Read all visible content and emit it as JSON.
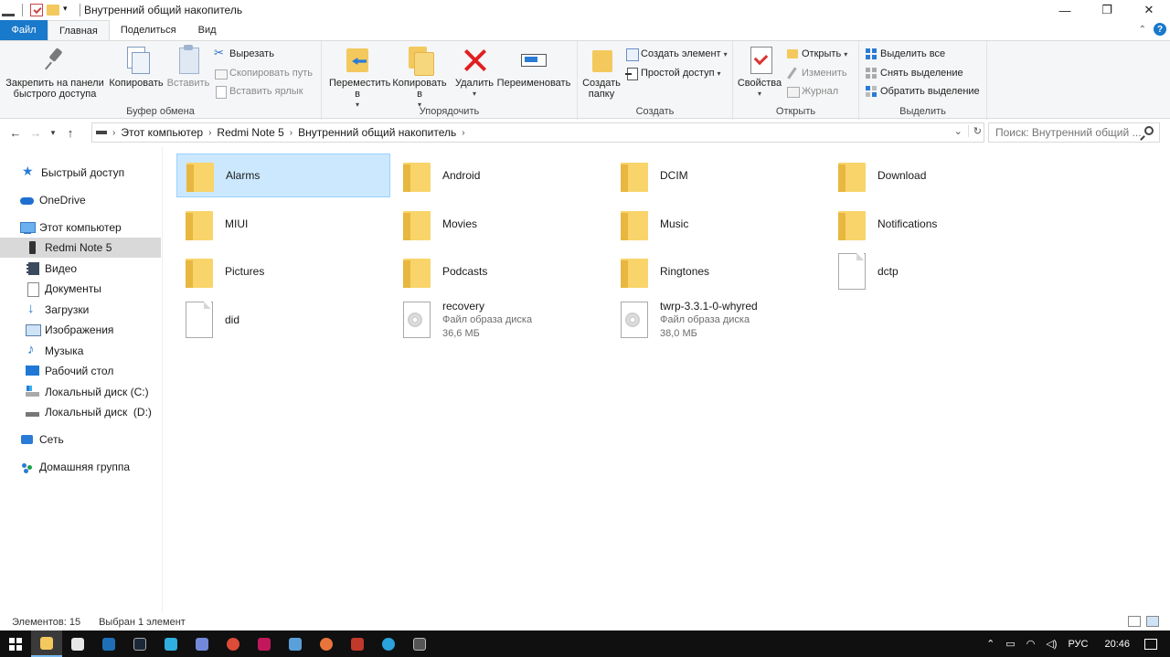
{
  "window": {
    "title": "Внутренний общий накопитель",
    "minimize": "—",
    "restore": "❐",
    "close": "✕"
  },
  "tabs": [
    {
      "label": "Файл"
    },
    {
      "label": "Главная"
    },
    {
      "label": "Поделиться"
    },
    {
      "label": "Вид"
    }
  ],
  "ribbon": {
    "clipboard": {
      "label": "Буфер обмена",
      "pin": "Закрепить на панели быстрого доступа",
      "copy": "Копировать",
      "paste": "Вставить",
      "cut": "Вырезать",
      "copy_path": "Скопировать путь",
      "paste_shortcut": "Вставить ярлык"
    },
    "organize": {
      "label": "Упорядочить",
      "move_to": "Переместить в",
      "copy_to": "Копировать в",
      "delete": "Удалить",
      "rename": "Переименовать"
    },
    "new": {
      "label": "Создать",
      "new_folder": "Создать папку",
      "new_item": "Создать элемент",
      "easy_access": "Простой доступ"
    },
    "open": {
      "label": "Открыть",
      "properties": "Свойства",
      "open": "Открыть",
      "edit": "Изменить",
      "history": "Журнал"
    },
    "select": {
      "label": "Выделить",
      "select_all": "Выделить все",
      "select_none": "Снять выделение",
      "invert": "Обратить выделение"
    }
  },
  "address": {
    "crumbs": [
      "Этот компьютер",
      "Redmi Note 5",
      "Внутренний общий накопитель"
    ],
    "search_placeholder": "Поиск: Внутренний общий ..."
  },
  "sidebar": {
    "items": [
      {
        "label": "Быстрый доступ",
        "icon": "star-icon"
      },
      {
        "label": "OneDrive",
        "icon": "cloud-icon"
      },
      {
        "label": "Этот компьютер",
        "icon": "computer-icon"
      },
      {
        "label": "Redmi Note 5",
        "icon": "phone-icon"
      },
      {
        "label": "Видео",
        "icon": "video-icon"
      },
      {
        "label": "Документы",
        "icon": "documents-icon"
      },
      {
        "label": "Загрузки",
        "icon": "downloads-icon"
      },
      {
        "label": "Изображения",
        "icon": "pictures-icon"
      },
      {
        "label": "Музыка",
        "icon": "music-icon"
      },
      {
        "label": "Рабочий стол",
        "icon": "desktop-icon"
      },
      {
        "label": "Локальный диск (C:)",
        "icon": "disk-c-icon"
      },
      {
        "label": "Локальный диск  (D:)",
        "icon": "disk-d-icon"
      },
      {
        "label": "Сеть",
        "icon": "network-icon"
      },
      {
        "label": "Домашняя группа",
        "icon": "homegroup-icon"
      }
    ]
  },
  "files": [
    {
      "name": "Alarms",
      "type": "folder"
    },
    {
      "name": "Android",
      "type": "folder"
    },
    {
      "name": "DCIM",
      "type": "folder"
    },
    {
      "name": "Download",
      "type": "folder"
    },
    {
      "name": "MIUI",
      "type": "folder"
    },
    {
      "name": "Movies",
      "type": "folder"
    },
    {
      "name": "Music",
      "type": "folder"
    },
    {
      "name": "Notifications",
      "type": "folder"
    },
    {
      "name": "Pictures",
      "type": "folder"
    },
    {
      "name": "Podcasts",
      "type": "folder"
    },
    {
      "name": "Ringtones",
      "type": "folder"
    },
    {
      "name": "dctp",
      "type": "file"
    },
    {
      "name": "did",
      "type": "file"
    },
    {
      "name": "recovery",
      "type": "disc",
      "kind": "Файл образа диска",
      "size": "36,6 МБ"
    },
    {
      "name": "twrp-3.3.1-0-whyred",
      "type": "disc",
      "kind": "Файл образа диска",
      "size": "38,0 МБ"
    }
  ],
  "status": {
    "count": "Элементов: 15",
    "selected": "Выбран 1 элемент"
  },
  "taskbar": {
    "tray_lang": "РУС",
    "time": "20:46",
    "apps": [
      "#f3c95e",
      "#e8e8e8",
      "#1e6fb8",
      "#1b2838",
      "#2fb0e0",
      "#7289da",
      "#dd4b39",
      "#c2185b",
      "#5aa0d8",
      "#e8743b",
      "#c0392b",
      "#2aa3dc",
      "#555555"
    ]
  },
  "colors": {
    "accent": "#1979ca",
    "selection": "#cce8ff",
    "folder": "#f8d46a"
  }
}
